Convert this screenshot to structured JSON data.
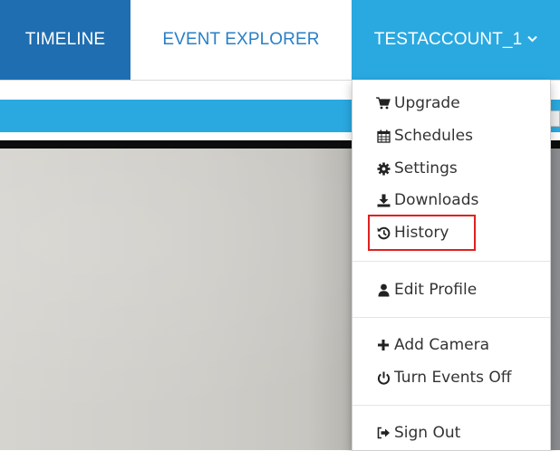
{
  "nav": {
    "timeline": "TIMELINE",
    "event_explorer": "EVENT EXPLORER",
    "account": "TESTACCOUNT_1"
  },
  "menu": {
    "upgrade": "Upgrade",
    "schedules": "Schedules",
    "settings": "Settings",
    "downloads": "Downloads",
    "history": "History",
    "edit_profile": "Edit Profile",
    "add_camera": "Add Camera",
    "turn_events_off": "Turn Events Off",
    "sign_out": "Sign Out"
  },
  "icons": {
    "upgrade": "cart-icon",
    "schedules": "calendar-icon",
    "settings": "gear-icon",
    "downloads": "download-icon",
    "history": "history-icon",
    "edit_profile": "user-icon",
    "add_camera": "plus-icon",
    "turn_events_off": "power-icon",
    "sign_out": "sign-out-icon",
    "account_dropdown": "chevron-down-icon"
  },
  "colors": {
    "timeline_tab": "#1f6eb1",
    "account_tab": "#2aa9e0",
    "explorer_text": "#2a7fc6",
    "highlight": "#e02020"
  }
}
